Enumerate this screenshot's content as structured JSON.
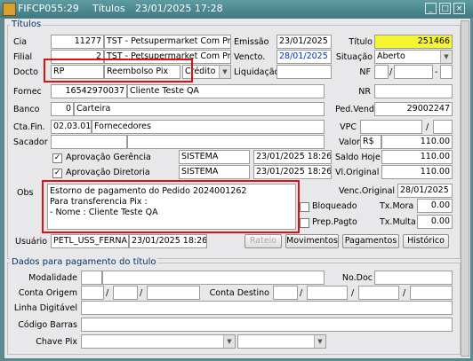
{
  "window": {
    "code": "FIFCP055:29",
    "title": "Títulos",
    "datetime": "23/01/2025 17:28"
  },
  "titulos": {
    "section_title": "Títulos",
    "cia": {
      "label": "Cia",
      "code": "11277",
      "name": "TST - Petsupermarket Com Pro"
    },
    "filial": {
      "label": "Filial",
      "code": "2",
      "name": "TST - Petsupermarket Com Pro"
    },
    "emissao": {
      "label": "Emissão",
      "value": "23/01/2025"
    },
    "vencto": {
      "label": "Vencto.",
      "value": "28/01/2025"
    },
    "titulo": {
      "label": "Título",
      "value": "251466"
    },
    "situacao": {
      "label": "Situação",
      "value": "Aberto"
    },
    "docto": {
      "label": "Docto",
      "code": "RP",
      "desc": "Reembolso Pix",
      "type": "Crédito"
    },
    "liquidacao": {
      "label": "Liquidação",
      "value": ""
    },
    "nf": {
      "label": "NF",
      "sep1": "/",
      "sep2": "-"
    },
    "fornec": {
      "label": "Fornec",
      "code": "16542970037",
      "name": "Cliente Teste QA"
    },
    "nr": {
      "label": "NR"
    },
    "banco": {
      "label": "Banco",
      "code": "0",
      "name": "Carteira"
    },
    "ped_venda": {
      "label": "Ped.Venda",
      "value": "29002247"
    },
    "cta_fin": {
      "label": "Cta.Fin.",
      "code": "02.03.01",
      "name": "Fornecedores"
    },
    "vpc": {
      "label": "VPC",
      "sep": "/"
    },
    "sacador": {
      "label": "Sacador"
    },
    "valor": {
      "label": "Valor",
      "currency": "R$",
      "value": "110.00"
    },
    "aprov_gerencia": {
      "label": "Aprovação Gerência",
      "user": "SISTEMA",
      "datetime": "23/01/2025 18:26"
    },
    "aprov_diretoria": {
      "label": "Aprovação Diretoria",
      "user": "SISTEMA",
      "datetime": "23/01/2025 18:26"
    },
    "saldo_hoje": {
      "label": "Saldo Hoje",
      "value": "110.00"
    },
    "vl_original": {
      "label": "Vl.Original",
      "value": "110.00"
    },
    "obs": {
      "label": "Obs",
      "lines": [
        "Estorno de pagamento do Pedido 2024001262",
        "Para transferencia Pix :",
        "- Nome   : Cliente Teste QA"
      ]
    },
    "venc_original": {
      "label": "Venc.Original",
      "value": "28/01/2025"
    },
    "bloqueado": {
      "label": "Bloqueado"
    },
    "tx_mora": {
      "label": "Tx.Mora",
      "value": "0.00"
    },
    "prep_pagto": {
      "label": "Prep.Pagto"
    },
    "tx_multa": {
      "label": "Tx.Multa",
      "value": "0.00"
    },
    "usuario": {
      "label": "Usuário",
      "user": "PETL_USS_FERNA",
      "datetime": "23/01/2025 18:26"
    },
    "buttons": {
      "rateio": "Rateio",
      "movimentos": "Movimentos",
      "pagamentos": "Pagamentos",
      "historico": "Histórico"
    }
  },
  "pagamento": {
    "section_title": "Dados para pagamento do título",
    "modalidade": "Modalidade",
    "no_doc": "No.Doc",
    "conta_origem": "Conta Origem",
    "conta_destino": "Conta Destino",
    "linha_digitavel": "Linha Digitável",
    "codigo_barras": "Código Barras",
    "chave_pix": "Chave Pix",
    "sep": "/"
  },
  "colors": {
    "titlebar": "#3f7a82",
    "highlight": "#f5f532",
    "annotation": "#e01010"
  }
}
